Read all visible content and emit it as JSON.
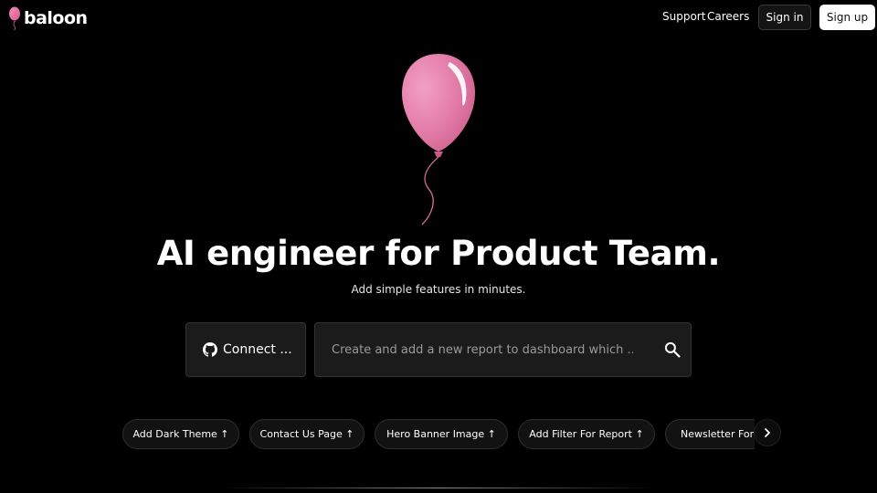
{
  "brand": {
    "name": "baloon",
    "accent_color": "#e06f9d"
  },
  "nav": {
    "support_label": "Support",
    "careers_label": "Careers",
    "signin_label": "Sign in",
    "signup_label": "Sign up"
  },
  "hero": {
    "title": "AI engineer for Product Team.",
    "subtitle": "Add simple features in minutes."
  },
  "connect": {
    "label": "Connect ...",
    "icon": "github-icon"
  },
  "prompt": {
    "placeholder": "Create and add a new report to dashboard which ...",
    "value": "",
    "icon": "search-icon"
  },
  "suggestions": [
    "Add Dark Theme ↑",
    "Contact Us Page ↑",
    "Hero Banner Image ↑",
    "Add Filter For Report ↑",
    "Newsletter Form ↑"
  ],
  "suggestions_next_icon": "chevron-right-icon"
}
